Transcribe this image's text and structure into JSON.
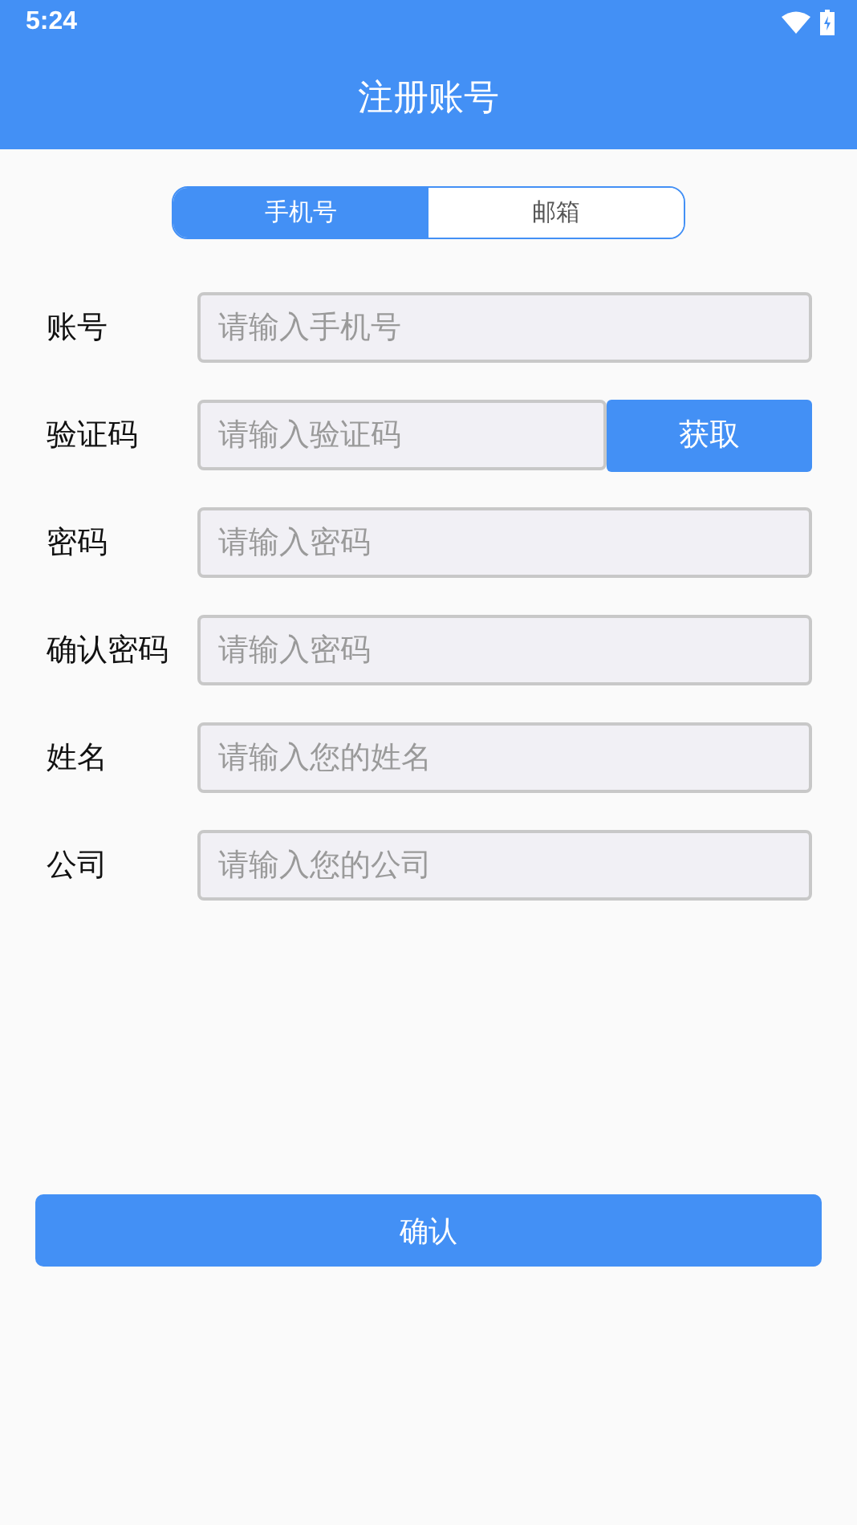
{
  "status_bar": {
    "time": "5:24"
  },
  "app_bar": {
    "title": "注册账号"
  },
  "tabs": [
    {
      "label": "手机号",
      "selected": true
    },
    {
      "label": "邮箱",
      "selected": false
    }
  ],
  "fields": [
    {
      "label": "账号",
      "placeholder": "请输入手机号"
    },
    {
      "label": "验证码",
      "placeholder": "请输入验证码",
      "button": "获取"
    },
    {
      "label": "密码",
      "placeholder": "请输入密码"
    },
    {
      "label": "确认密码",
      "placeholder": "请输入密码"
    },
    {
      "label": "姓名",
      "placeholder": "请输入您的姓名"
    },
    {
      "label": "公司",
      "placeholder": "请输入您的公司"
    }
  ],
  "confirm_button": "确认"
}
